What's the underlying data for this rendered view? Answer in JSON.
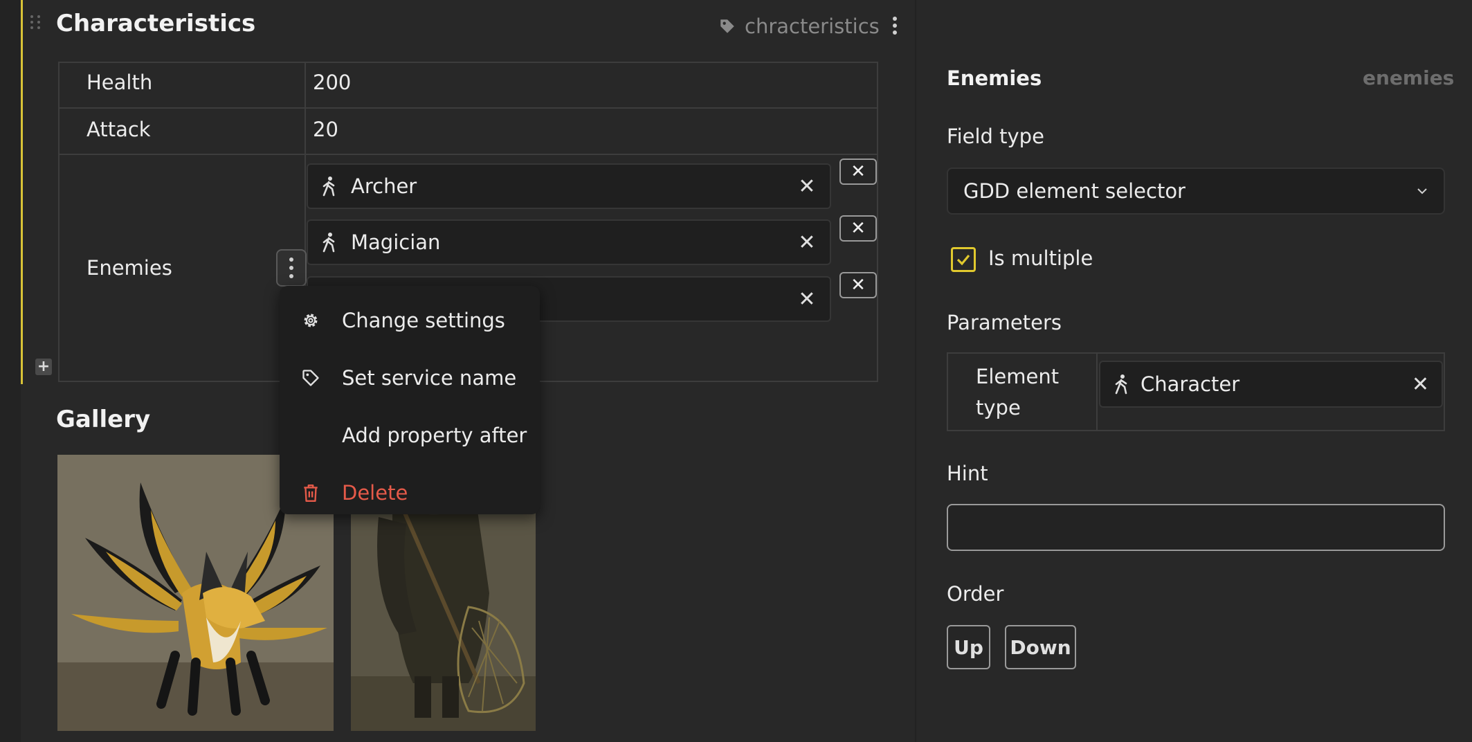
{
  "characteristics": {
    "title": "Characteristics",
    "service_name": "chracteristics",
    "rows": [
      {
        "key": "Health",
        "value": "200"
      },
      {
        "key": "Attack",
        "value": "20"
      },
      {
        "key": "Enemies",
        "chips": [
          "Archer",
          "Magician"
        ]
      }
    ],
    "remove_label": "✕"
  },
  "context_menu": {
    "items": [
      {
        "label": "Change settings",
        "icon": "gear-icon"
      },
      {
        "label": "Set service name",
        "icon": "tag-icon"
      },
      {
        "label": "Add property after",
        "icon": ""
      },
      {
        "label": "Delete",
        "icon": "trash-icon",
        "color": "#e55a49"
      }
    ]
  },
  "gallery": {
    "title": "Gallery"
  },
  "field_settings": {
    "title": "Enemies",
    "service_name": "enemies",
    "field_type_label": "Field type",
    "field_type_value": "GDD element selector",
    "is_multiple_label": "Is multiple",
    "is_multiple_checked": true,
    "parameters_label": "Parameters",
    "parameters": [
      {
        "key": "Element type",
        "chip": "Character"
      }
    ],
    "hint_label": "Hint",
    "hint_value": "",
    "order_label": "Order",
    "up_label": "Up",
    "down_label": "Down"
  },
  "colors": {
    "accent": "#d9c337",
    "danger": "#e55a49",
    "background": "#282828"
  }
}
